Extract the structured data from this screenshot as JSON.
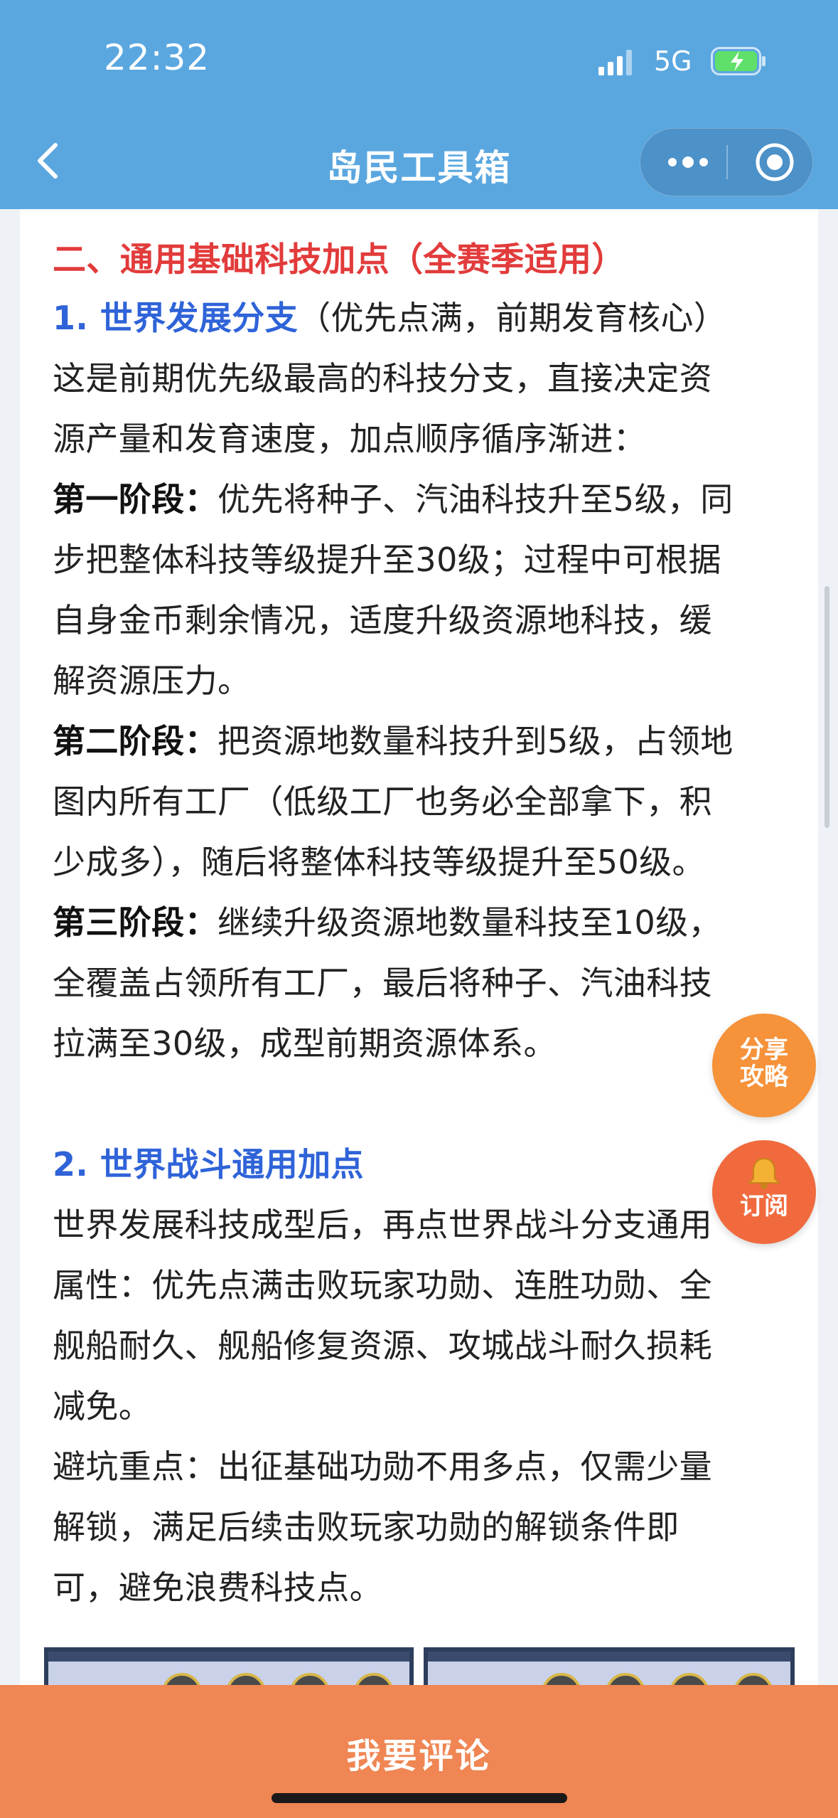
{
  "status_bar": {
    "time": "22:32",
    "network": "5G"
  },
  "nav": {
    "title": "岛民工具箱"
  },
  "article": {
    "section_heading": "二、通用基础科技加点（全赛季适用）",
    "sub1_title": "1. 世界发展分支",
    "sub1_note": "（优先点满，前期发育核心）",
    "p1_lines": [
      "这是前期优先级最高的科技分支，直接决定资",
      "源产量和发育速度，加点顺序循序渐进："
    ],
    "stage1_label": "第一阶段：",
    "stage1_lines": [
      "优先将种子、汽油科技升至5级，同",
      "步把整体科技等级提升至30级；过程中可根据",
      "自身金币剩余情况，适度升级资源地科技，缓",
      "解资源压力。"
    ],
    "stage2_label": "第二阶段：",
    "stage2_lines": [
      "把资源地数量科技升到5级，占领地",
      "图内所有工厂（低级工厂也务必全部拿下，积",
      "少成多），随后将整体科技等级提升至50级。"
    ],
    "stage3_label": "第三阶段：",
    "stage3_lines": [
      "继续升级资源地数量科技至10级，",
      "全覆盖占领所有工厂，最后将种子、汽油科技",
      "拉满至30级，成型前期资源体系。"
    ],
    "sub2_title": "2. 世界战斗通用加点",
    "p2_lines": [
      "世界发展科技成型后，再点世界战斗分支通用",
      "属性：优先点满击败玩家功勋、连胜功勋、全",
      "舰船耐久、舰船修复资源、攻城战斗耐久损耗",
      "减免。",
      "避坑重点：出征基础功勋不用多点，仅需少量",
      "解锁，满足后续击败玩家功勋的解锁条件即",
      "可，避免浪费科技点。"
    ]
  },
  "floating": {
    "share_line1": "分享",
    "share_line2": "攻略",
    "subscribe": "订阅"
  },
  "bottom": {
    "comment": "我要评论"
  }
}
